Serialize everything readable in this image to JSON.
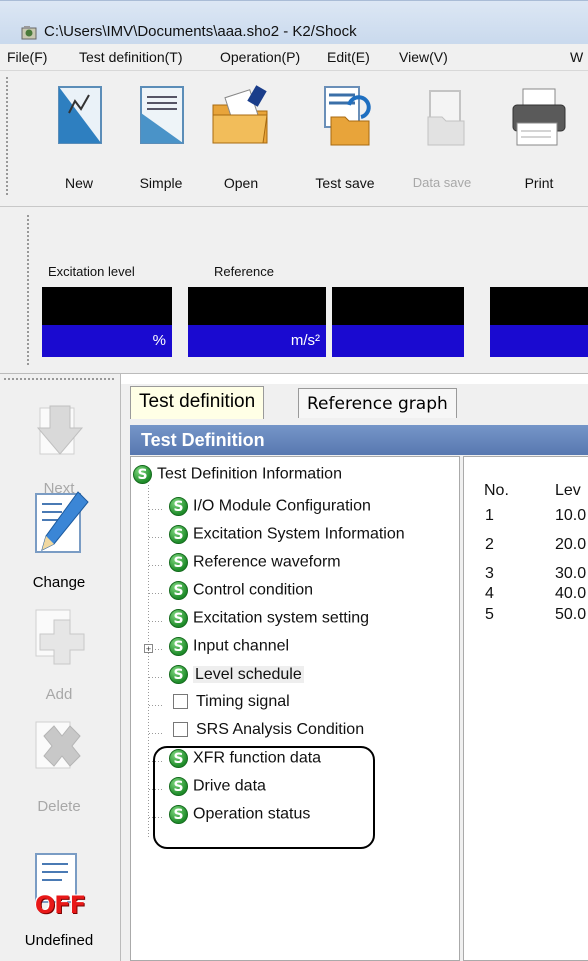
{
  "window": {
    "title": "C:\\Users\\IMV\\Documents\\aaa.sho2 - K2/Shock"
  },
  "menu": [
    "File(F)",
    "Test definition(T)",
    "Operation(P)",
    "Edit(E)",
    "View(V)",
    "W"
  ],
  "toolbar": {
    "new": "New",
    "simple": "Simple",
    "open": "Open",
    "test_save": "Test save",
    "data_save": "Data save",
    "print": "Print"
  },
  "level_panel": {
    "excitation_caption": "Excitation level",
    "reference_caption": "Reference",
    "excitation_unit": "%",
    "reference_unit": "m/s²"
  },
  "sidebar": {
    "next": "Next",
    "change": "Change",
    "add": "Add",
    "delete": "Delete",
    "undefined": "Undefined",
    "off_badge": "OFF"
  },
  "tabs": [
    "Test definition",
    "Reference graph"
  ],
  "section_header": "Test Definition",
  "tree": {
    "root": "Test Definition Information",
    "items": [
      "I/O Module Configuration",
      "Excitation System Information",
      "Reference waveform",
      "Control condition",
      "Excitation system setting",
      "Input channel",
      "Level schedule",
      "Timing signal",
      "SRS Analysis Condition",
      "XFR function data",
      "Drive data",
      "Operation status"
    ],
    "s_letter": "S"
  },
  "table": {
    "headers": [
      "No.",
      "Lev"
    ],
    "rows": [
      [
        "1",
        "10.0"
      ],
      [
        "2",
        "20.0"
      ],
      [
        "3",
        "30.0"
      ],
      [
        "4",
        "40.0"
      ],
      [
        "5",
        "50.0"
      ]
    ]
  }
}
